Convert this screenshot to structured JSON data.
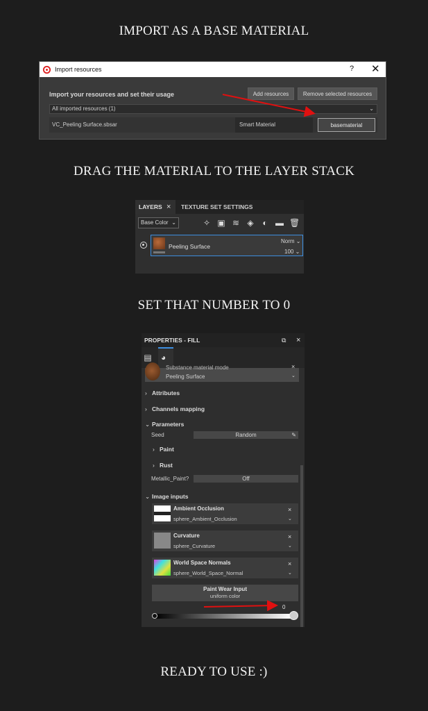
{
  "headings": {
    "step1": "IMPORT AS A BASE MATERIAL",
    "step2": "DRAG THE MATERIAL TO THE LAYER STACK",
    "step3": "SET THAT NUMBER TO 0",
    "step4": "READY TO USE :)"
  },
  "import_dialog": {
    "title": "Import resources",
    "help": "?",
    "close": "✕",
    "instruction": "Import your resources and set their usage",
    "add_button": "Add resources",
    "remove_button": "Remove selected resources",
    "filter": "All imported resources (1)",
    "file": {
      "name": "VC_Peeling Surface.sbsar",
      "usage": "Smart Material",
      "type": "basematerial"
    }
  },
  "layers_panel": {
    "tab_layers": "LAYERS",
    "tab_texture": "TEXTURE SET SETTINGS",
    "channel": "Base Color",
    "layer": {
      "name": "Peeling Surface",
      "blend": "Norm",
      "opacity": "100"
    }
  },
  "properties_panel": {
    "title": "PROPERTIES - FILL",
    "material_mode": "Substance material mode",
    "material_name": "Peeling Surface",
    "sections": {
      "attributes": "Attributes",
      "channels": "Channels mapping",
      "parameters": "Parameters",
      "paint": "Paint",
      "rust": "Rust",
      "image_inputs": "Image inputs"
    },
    "seed_label": "Seed",
    "seed_value": "Random",
    "metallic_label": "Metallic_Paint?",
    "metallic_value": "Off",
    "image_inputs": [
      {
        "name": "Ambient Occlusion",
        "source": "sphere_Ambient_Occlusion"
      },
      {
        "name": "Curvature",
        "source": "sphere_Curvature"
      },
      {
        "name": "World Space Normals",
        "source": "sphere_World_Space_Normal"
      }
    ],
    "paint_wear_title": "Paint Wear Input",
    "paint_wear_value": "uniform color",
    "slider_value": "0"
  },
  "colors": {
    "background": "#1d1d1d",
    "annotation_arrow": "#e01010",
    "selection_blue": "#3d8ee0"
  }
}
